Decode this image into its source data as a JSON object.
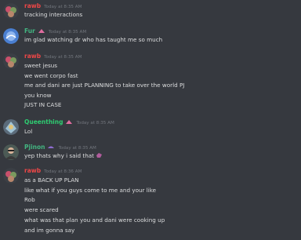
{
  "colors": {
    "background": "#36393f",
    "text": "#dcddde",
    "timestamp": "#72767d",
    "rawb": "#f04747",
    "fur": "#43b581",
    "queenthing": "#2ecc71",
    "pjinon": "#43b581"
  },
  "messages": [
    {
      "author": "rawb",
      "timestamp": "Today at 8:35 AM",
      "lines": [
        "tracking interactions"
      ]
    },
    {
      "author": "Fur",
      "timestamp": "Today at 8:35 AM",
      "lines": [
        "im glad watching dr who has taught me so much"
      ]
    },
    {
      "author": "rawb",
      "timestamp": "Today at 8:35 AM",
      "lines": [
        "sweet jesus",
        "we went corpo fast",
        "me and dani are just PLANNING to take over the world PJ",
        "you know",
        "JUST IN CASE"
      ]
    },
    {
      "author": "Queenthing",
      "timestamp": "Today at 8:35 AM",
      "lines": [
        "Lol"
      ]
    },
    {
      "author": "Pjinon",
      "timestamp": "Today at 8:35 AM",
      "lines": [
        "yep thats why i said that"
      ]
    },
    {
      "author": "rawb",
      "timestamp": "Today at 8:36 AM",
      "lines": [
        "as a BACK UP PLAN",
        "like what if you guys come to me and your like",
        "Rob",
        "were scared",
        "what was that plan you and dani were cooking up",
        "and im gonna say"
      ]
    }
  ]
}
